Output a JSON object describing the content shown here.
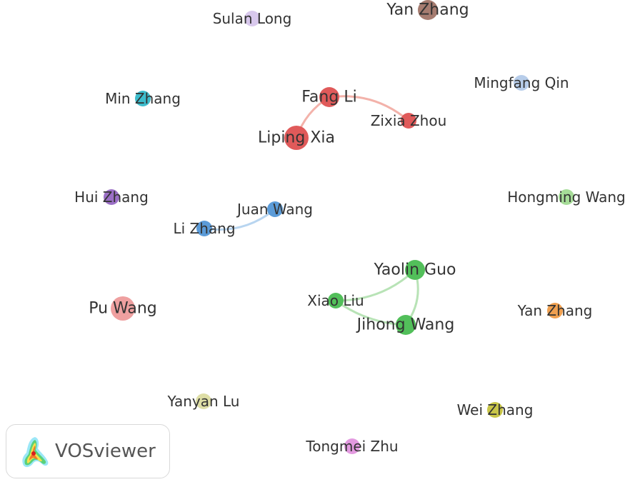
{
  "network": {
    "nodes": [
      {
        "id": "n1",
        "label": "Sulan Long",
        "color": "#d8c8ec",
        "weight": 1
      },
      {
        "id": "n2",
        "label": "Yan Zhang",
        "color": "#a67c70",
        "weight": 2
      },
      {
        "id": "n3",
        "label": "Mingfang Qin",
        "color": "#b7cdea",
        "weight": 1
      },
      {
        "id": "n4",
        "label": "Min Zhang",
        "color": "#3dbccc",
        "weight": 1
      },
      {
        "id": "n5",
        "label": "Fang Li",
        "color": "#e05a5a",
        "weight": 2
      },
      {
        "id": "n6",
        "label": "Zixia Zhou",
        "color": "#e05a5a",
        "weight": 1
      },
      {
        "id": "n7",
        "label": "Liping Xia",
        "color": "#e05a5a",
        "weight": 3
      },
      {
        "id": "n8",
        "label": "Hui Zhang",
        "color": "#9b6fc6",
        "weight": 1
      },
      {
        "id": "n9",
        "label": "Juan Wang",
        "color": "#5b9bd8",
        "weight": 1
      },
      {
        "id": "n10",
        "label": "Li Zhang",
        "color": "#5b9bd8",
        "weight": 1
      },
      {
        "id": "n11",
        "label": "Hongming Wang",
        "color": "#a6dc98",
        "weight": 1
      },
      {
        "id": "n12",
        "label": "Yaolin Guo",
        "color": "#52bf5a",
        "weight": 2
      },
      {
        "id": "n13",
        "label": "Xiao Liu",
        "color": "#52bf5a",
        "weight": 1
      },
      {
        "id": "n14",
        "label": "Jihong Wang",
        "color": "#52bf5a",
        "weight": 2
      },
      {
        "id": "n15",
        "label": "Pu Wang",
        "color": "#efa0a0",
        "weight": 3
      },
      {
        "id": "n16",
        "label": "Yan Zhang",
        "color": "#f0a050",
        "weight": 1
      },
      {
        "id": "n17",
        "label": "Yanyan Lu",
        "color": "#dedea6",
        "weight": 1
      },
      {
        "id": "n18",
        "label": "Wei Zhang",
        "color": "#c9c648",
        "weight": 1
      },
      {
        "id": "n19",
        "label": "Tongmei Zhu",
        "color": "#e39ae0",
        "weight": 1
      }
    ],
    "edges": [
      {
        "source": "n7",
        "target": "n5",
        "color": "#f3b2aa"
      },
      {
        "source": "n5",
        "target": "n6",
        "color": "#f3b2aa"
      },
      {
        "source": "n9",
        "target": "n10",
        "color": "#b8d5f0"
      },
      {
        "source": "n13",
        "target": "n12",
        "color": "#b8e3b6"
      },
      {
        "source": "n12",
        "target": "n14",
        "color": "#b8e3b6"
      },
      {
        "source": "n13",
        "target": "n14",
        "color": "#b8e3b6"
      }
    ]
  },
  "branding": {
    "name": "VOSviewer",
    "logo_icon": "vosviewer-logo-icon"
  }
}
